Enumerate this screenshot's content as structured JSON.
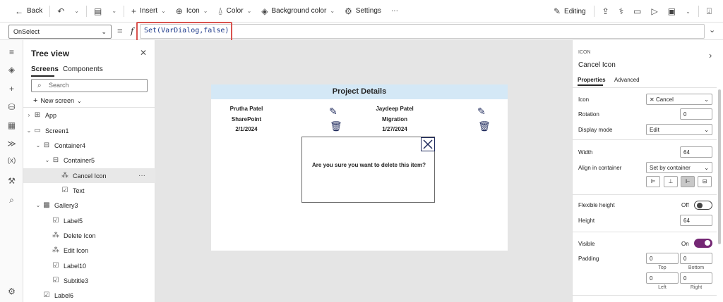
{
  "toolbar": {
    "back": "Back",
    "insert": "Insert",
    "icon": "Icon",
    "color": "Color",
    "background_color": "Background color",
    "settings": "Settings",
    "more": "···",
    "editing": "Editing"
  },
  "formula_bar": {
    "property": "OnSelect",
    "formula": "Set(VarDialog,false)"
  },
  "tree": {
    "title": "Tree view",
    "tabs": [
      "Screens",
      "Components"
    ],
    "search_placeholder": "Search",
    "new_screen": "New screen",
    "nodes": [
      {
        "label": "App",
        "icon": "app-icon"
      },
      {
        "label": "Screen1",
        "icon": "screen-icon"
      },
      {
        "label": "Container4",
        "icon": "container-icon"
      },
      {
        "label": "Container5",
        "icon": "container-icon"
      },
      {
        "label": "Cancel Icon",
        "icon": "icon-control-icon",
        "selected": true
      },
      {
        "label": "Text",
        "icon": "label-icon"
      },
      {
        "label": "Gallery3",
        "icon": "gallery-icon"
      },
      {
        "label": "Label5",
        "icon": "label-icon"
      },
      {
        "label": "Delete Icon",
        "icon": "icon-control-icon"
      },
      {
        "label": "Edit Icon",
        "icon": "icon-control-icon"
      },
      {
        "label": "Label10",
        "icon": "label-icon"
      },
      {
        "label": "Subtitle3",
        "icon": "label-icon"
      },
      {
        "label": "Label6",
        "icon": "label-icon"
      }
    ]
  },
  "canvas": {
    "header": "Project Details",
    "items": [
      {
        "name": "Prutha Patel",
        "project": "SharePoint",
        "date": "2/1/2024"
      },
      {
        "name": "Jaydeep Patel",
        "project": "Migration",
        "date": "1/27/2024"
      }
    ],
    "dialog_text": "Are you sure you want to delete this item?"
  },
  "properties": {
    "kind": "ICON",
    "name": "Cancel Icon",
    "tabs": [
      "Properties",
      "Advanced"
    ],
    "icon_label": "Icon",
    "icon_value": "Cancel",
    "rotation_label": "Rotation",
    "rotation_value": "0",
    "display_mode_label": "Display mode",
    "display_mode_value": "Edit",
    "width_label": "Width",
    "width_value": "64",
    "align_label": "Align in container",
    "align_value": "Set by container",
    "flexible_height_label": "Flexible height",
    "flexible_height_state": "Off",
    "height_label": "Height",
    "height_value": "64",
    "visible_label": "Visible",
    "visible_state": "On",
    "padding_label": "Padding",
    "padding_top": "0",
    "padding_bottom": "0",
    "padding_left": "0",
    "padding_right": "0",
    "top_label": "Top",
    "bottom_label": "Bottom",
    "left_label": "Left",
    "right_label": "Right"
  }
}
